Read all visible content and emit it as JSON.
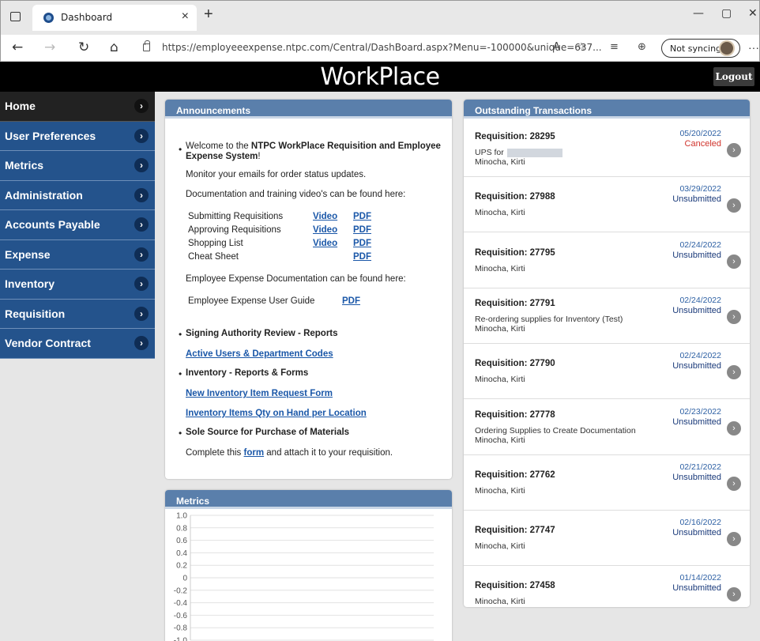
{
  "browser": {
    "tab_title": "Dashboard",
    "tab_close": "×",
    "new_tab": "+",
    "url": "https://employeeexpense.ntpc.com/Central/DashBoard.aspx?Menu=-100000&unique=637...",
    "sync_label": "Not syncing",
    "minimize": "—",
    "maximize": "▢",
    "close": "✕",
    "back": "←",
    "forward": "→",
    "refresh": "↻",
    "home": "⌂",
    "read_aloud": "A",
    "favorite": "☆",
    "favorites": "≡",
    "collections": "⊕",
    "more": "···"
  },
  "header": {
    "logo": "WorkPlace",
    "logout": "Logout"
  },
  "sidebar": {
    "arrow": "›",
    "items": [
      {
        "label": "Home"
      },
      {
        "label": "User Preferences"
      },
      {
        "label": "Metrics"
      },
      {
        "label": "Administration"
      },
      {
        "label": "Accounts Payable"
      },
      {
        "label": "Expense"
      },
      {
        "label": "Inventory"
      },
      {
        "label": "Requisition"
      },
      {
        "label": "Vendor Contract"
      }
    ]
  },
  "announcements": {
    "title": "Announcements",
    "welcome_pre": "Welcome to the ",
    "welcome_bold": "NTPC WorkPlace Requisition and Employee",
    "welcome_bold2": "Expense System",
    "welcome_end": "!",
    "monitor": "Monitor your emails for order status updates.",
    "doc_intro": "Documentation and training video's can be found here:",
    "docs": [
      {
        "name": "Submitting Requisitions",
        "video": "Video",
        "pdf": "PDF"
      },
      {
        "name": "Approving Requisitions",
        "video": "Video",
        "pdf": "PDF"
      },
      {
        "name": "Shopping List",
        "video": "Video",
        "pdf": "PDF"
      },
      {
        "name": "Cheat Sheet",
        "video": "",
        "pdf": "PDF"
      }
    ],
    "exp_intro": "Employee Expense Documentation can be found here:",
    "exp_guide": "Employee Expense User Guide",
    "exp_pdf": "PDF",
    "signing": "Signing Authority Review - Reports",
    "active_users": "Active Users & Department Codes",
    "inventory": "Inventory - Reports & Forms",
    "new_item": "New Inventory Item Request Form",
    "qty_on_hand": "Inventory Items Qty on Hand per Location",
    "sole_source": "Sole Source for Purchase of Materials",
    "complete_pre": "Complete this ",
    "complete_link": "form",
    "complete_post": " and attach it to your requisition."
  },
  "metrics": {
    "title": "Metrics",
    "yticks": [
      "1.0",
      "0.8",
      "0.6",
      "0.4",
      "0.2",
      "0",
      "-0.2",
      "-0.4",
      "-0.6",
      "-0.8",
      "-1.0"
    ]
  },
  "chart_data": {
    "type": "line",
    "title": "",
    "xlabel": "",
    "ylabel": "",
    "ylim": [
      -1.0,
      1.0
    ],
    "series": [],
    "grid": true
  },
  "outstanding": {
    "title": "Outstanding Transactions",
    "transactions": [
      {
        "req": "Requisition: 28295",
        "desc": "UPS for",
        "name": "Minocha, Kirti",
        "date": "05/20/2022",
        "status": "Canceled",
        "status_color": "#d0342c"
      },
      {
        "req": "Requisition: 27988",
        "desc": "",
        "name": "Minocha, Kirti",
        "date": "03/29/2022",
        "status": "Unsubmitted",
        "status_color": "#1a3a7a"
      },
      {
        "req": "Requisition: 27795",
        "desc": "",
        "name": "Minocha, Kirti",
        "date": "02/24/2022",
        "status": "Unsubmitted",
        "status_color": "#1a3a7a"
      },
      {
        "req": "Requisition: 27791",
        "desc": "Re-ordering supplies for Inventory (Test)",
        "name": "Minocha, Kirti",
        "date": "02/24/2022",
        "status": "Unsubmitted",
        "status_color": "#1a3a7a"
      },
      {
        "req": "Requisition: 27790",
        "desc": "",
        "name": "Minocha, Kirti",
        "date": "02/24/2022",
        "status": "Unsubmitted",
        "status_color": "#1a3a7a"
      },
      {
        "req": "Requisition: 27778",
        "desc": "Ordering Supplies to Create Documentation",
        "name": "Minocha, Kirti",
        "date": "02/23/2022",
        "status": "Unsubmitted",
        "status_color": "#1a3a7a"
      },
      {
        "req": "Requisition: 27762",
        "desc": "",
        "name": "Minocha, Kirti",
        "date": "02/21/2022",
        "status": "Unsubmitted",
        "status_color": "#1a3a7a"
      },
      {
        "req": "Requisition: 27747",
        "desc": "",
        "name": "Minocha, Kirti",
        "date": "02/16/2022",
        "status": "Unsubmitted",
        "status_color": "#1a3a7a"
      },
      {
        "req": "Requisition: 27458",
        "desc": "",
        "name": "Minocha, Kirti",
        "date": "01/14/2022",
        "status": "Unsubmitted",
        "status_color": "#1a3a7a"
      }
    ]
  }
}
